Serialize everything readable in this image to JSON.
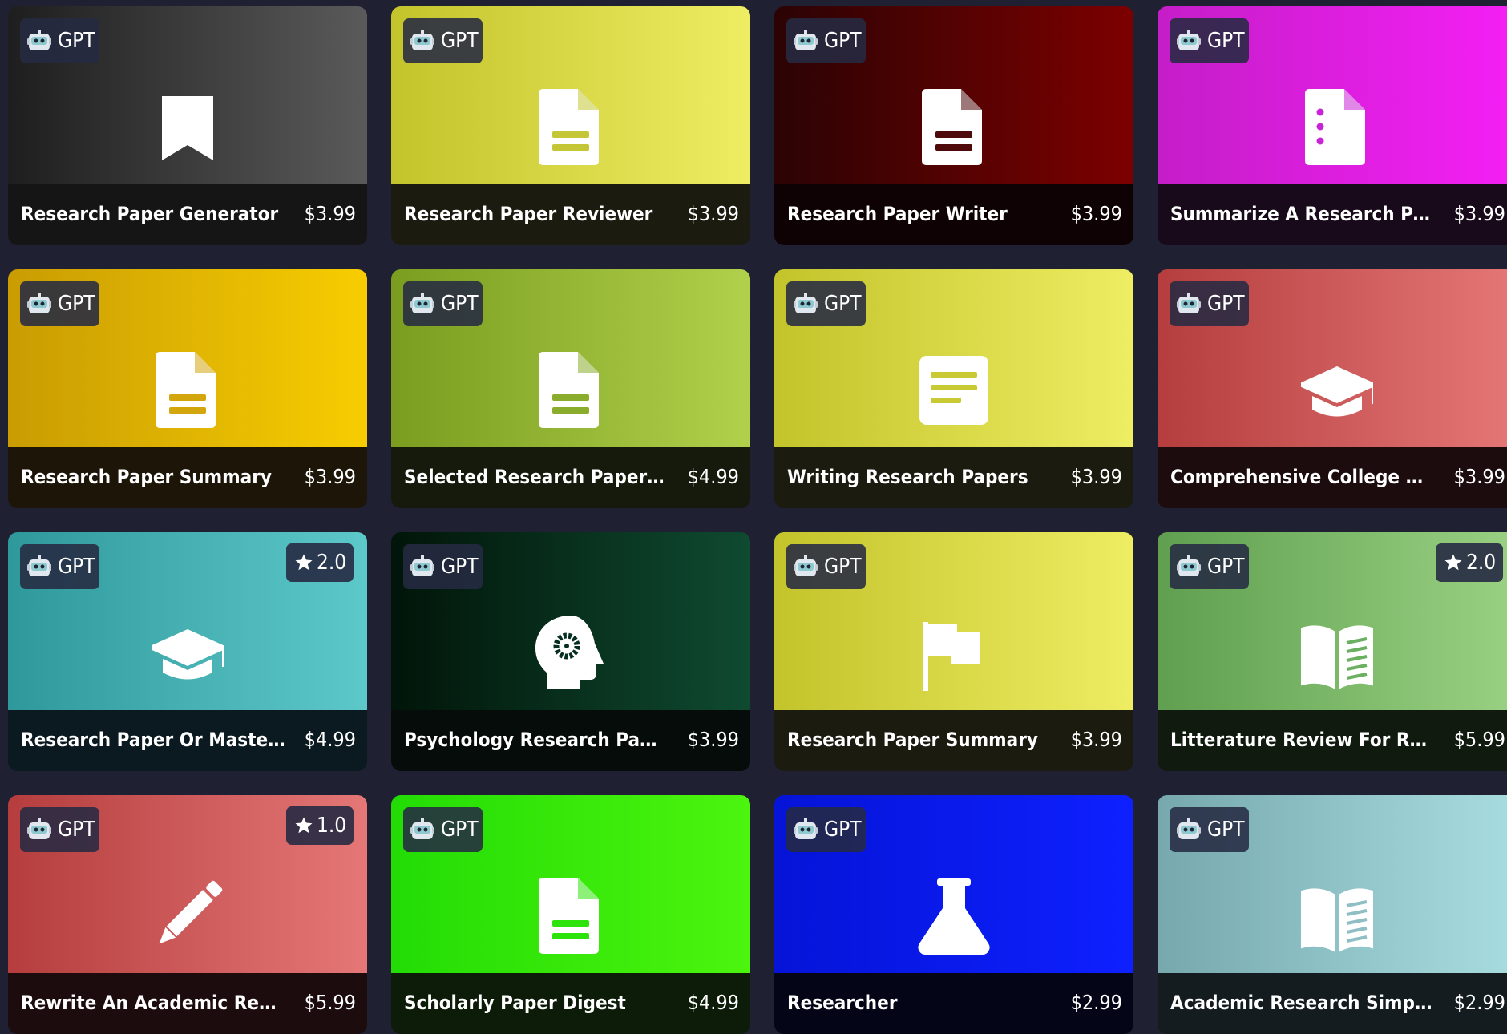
{
  "badge_label": "GPT",
  "cards": [
    {
      "name": "Research Paper Generator",
      "price": "$3.99",
      "icon": "bookmark-icon",
      "icon_color": "#3d3d3d",
      "gradient": [
        "#1e1e1e",
        "#5a5a5a"
      ],
      "footer_color": "#151515"
    },
    {
      "name": "Research Paper Reviewer",
      "price": "$3.99",
      "icon": "document-icon",
      "icon_color": "#c4c635",
      "gradient": [
        "#c3c32b",
        "#eeed63"
      ],
      "footer_color": "#1b1b10"
    },
    {
      "name": "Research Paper Writer",
      "price": "$3.99",
      "icon": "document-icon",
      "icon_color": "#4e0a0a",
      "gradient": [
        "#2b0304",
        "#7d0000"
      ],
      "footer_color": "#0e0204"
    },
    {
      "name": "Summarize A Research Paper",
      "price": "$3.99",
      "icon": "document-list-icon",
      "icon_color": "#c624d6",
      "gradient": [
        "#c41ec8",
        "#f51ff5"
      ],
      "footer_color": "#180a1a"
    },
    {
      "name": "Research Paper Summary",
      "price": "$3.99",
      "icon": "document-icon",
      "icon_color": "#d4a60e",
      "gradient": [
        "#c99c02",
        "#f7cd01"
      ],
      "footer_color": "#1d1608"
    },
    {
      "name": "Selected Research Papers Rep...",
      "price": "$4.99",
      "icon": "document-icon",
      "icon_color": "#8aad2d",
      "gradient": [
        "#7a9d20",
        "#b1d04b"
      ],
      "footer_color": "#151a0c"
    },
    {
      "name": "Writing Research Papers",
      "price": "$3.99",
      "icon": "text-lines-icon",
      "icon_color": "#c9ca33",
      "gradient": [
        "#c3c32b",
        "#eeed63"
      ],
      "footer_color": "#1b1b10"
    },
    {
      "name": "Comprehensive College Resea...",
      "price": "$3.99",
      "icon": "graduation-cap-icon",
      "icon_color": "#c64a4a",
      "gradient": [
        "#b53d3d",
        "#e57777"
      ],
      "footer_color": "#1c0c0e"
    },
    {
      "name": "Research Paper Or Master The...",
      "price": "$4.99",
      "icon": "graduation-cap-icon",
      "icon_color": "#3aa5a8",
      "gradient": [
        "#2f989b",
        "#5dc8c9"
      ],
      "footer_color": "#0b1a20",
      "rating": "2.0"
    },
    {
      "name": "Psychology Research Paper To...",
      "price": "$3.99",
      "icon": "head-gear-icon",
      "icon_color": "#062f20",
      "gradient": [
        "#011509",
        "#0f4a31"
      ],
      "footer_color": "#050c0a"
    },
    {
      "name": "Research Paper Summary",
      "price": "$3.99",
      "icon": "flag-icon",
      "icon_color": "#c9ca33",
      "gradient": [
        "#c3c32b",
        "#eeed63"
      ],
      "footer_color": "#1b1b10"
    },
    {
      "name": "Litterature Review For Resear...",
      "price": "$5.99",
      "icon": "open-book-icon",
      "icon_color": "#6ab060",
      "gradient": [
        "#5f9f4f",
        "#9ad183"
      ],
      "footer_color": "#101a0e",
      "rating": "2.0"
    },
    {
      "name": "Rewrite An Academic Researc...",
      "price": "$5.99",
      "icon": "pencil-icon",
      "icon_color": "#c64a4a",
      "gradient": [
        "#b53d3d",
        "#e57777"
      ],
      "footer_color": "#1c0c0e",
      "rating": "1.0"
    },
    {
      "name": "Scholarly Paper Digest",
      "price": "$4.99",
      "icon": "document-icon",
      "icon_color": "#2ee30b",
      "gradient": [
        "#23dc05",
        "#4cf50e"
      ],
      "footer_color": "#0c1c08"
    },
    {
      "name": "Researcher",
      "price": "$2.99",
      "icon": "flask-icon",
      "icon_color": "#0a18e6",
      "gradient": [
        "#0514d7",
        "#0e20ff"
      ],
      "footer_color": "#050518"
    },
    {
      "name": "Academic Research Simplifier",
      "price": "$2.99",
      "icon": "open-book-icon",
      "icon_color": "#8fbec4",
      "gradient": [
        "#76a8ae",
        "#a8dde0"
      ],
      "footer_color": "#141c20"
    }
  ]
}
